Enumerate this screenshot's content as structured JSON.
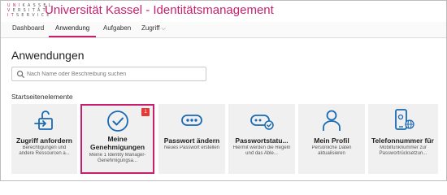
{
  "header": {
    "logo_lines": [
      {
        "accent": "U N I ",
        "rest": "K A S S E L"
      },
      {
        "accent": "",
        "rest": "V E R S I T Ä T"
      },
      {
        "accent": "",
        "rest": "S E R V I C E"
      }
    ],
    "title": "Universität Kassel - Identitätsmanagement"
  },
  "nav": {
    "items": [
      {
        "label": "Dashboard"
      },
      {
        "label": "Anwendung"
      },
      {
        "label": "Aufgaben"
      },
      {
        "label": "Zugriff"
      }
    ],
    "active_index": 1
  },
  "page": {
    "title": "Anwendungen",
    "search_placeholder": "Nach Name oder Beschreibung suchen",
    "section_label": "Startseitenelemente"
  },
  "tiles": [
    {
      "title": "Zugriff anfordern",
      "desc": "Berechtigungen und andere Ressourcen a...",
      "icon": "access-request-icon"
    },
    {
      "title": "Meine Genehmigungen",
      "title_line1": "Meine",
      "title_line2": "Genehmigungen",
      "desc": "Meine 1 Identity Manager-Genehmigungsa...",
      "icon": "checkmark-circle-icon",
      "badge": "1",
      "selected": true
    },
    {
      "title": "Passwort ändern",
      "desc": "Neues Passwort erstellen",
      "icon": "password-dots-icon"
    },
    {
      "title": "Passwortstatu...",
      "desc": "Hiermit werden die Regeln und das Able...",
      "icon": "password-status-icon"
    },
    {
      "title": "Mein Profil",
      "desc": "Persönliche Daten aktualisieren",
      "icon": "person-profile-icon"
    },
    {
      "title": "Telefonnummer für „P...",
      "desc": "Mobilfunknummer zur Passwortrücksetzun...",
      "icon": "phone-globe-icon"
    }
  ],
  "colors": {
    "accent": "#c81e6e",
    "icon_blue": "#1a6ab3",
    "badge_red": "#e53935",
    "tile_bg": "#f0f0f0"
  }
}
